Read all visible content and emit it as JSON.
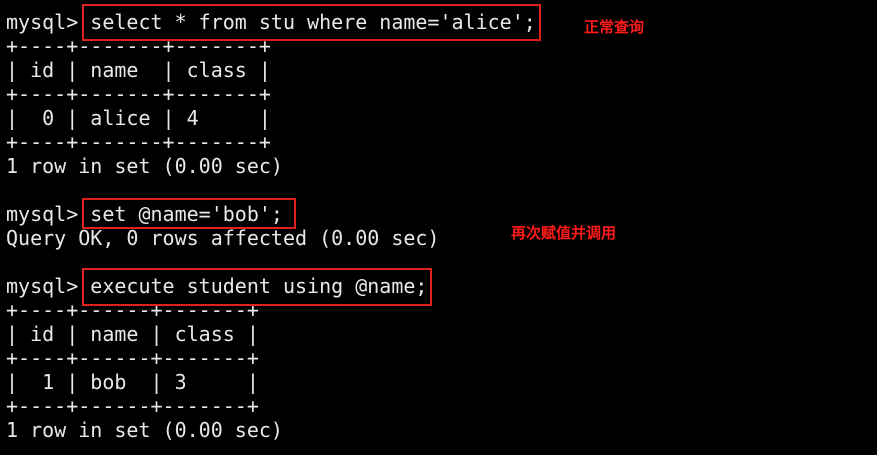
{
  "terminal": {
    "lines": [
      "mysql> select * from stu where name='alice';",
      "+----+-------+-------+",
      "| id | name  | class |",
      "+----+-------+-------+",
      "|  0 | alice | 4     |",
      "+----+-------+-------+",
      "1 row in set (0.00 sec)",
      "",
      "mysql> set @name='bob';",
      "Query OK, 0 rows affected (0.00 sec)",
      "",
      "mysql> execute student using @name;",
      "+----+------+-------+",
      "| id | name | class |",
      "+----+------+-------+",
      "|  1 | bob  | 3     |",
      "+----+------+-------+",
      "1 row in set (0.00 sec)"
    ]
  },
  "annotations": {
    "normal_query": "正常查询",
    "reassign_and_call": "再次赋值并调用"
  },
  "colors": {
    "background": "#000000",
    "text": "#e8e8e8",
    "highlight_box": "#e0201c",
    "annotation": "#ff1a1a"
  }
}
